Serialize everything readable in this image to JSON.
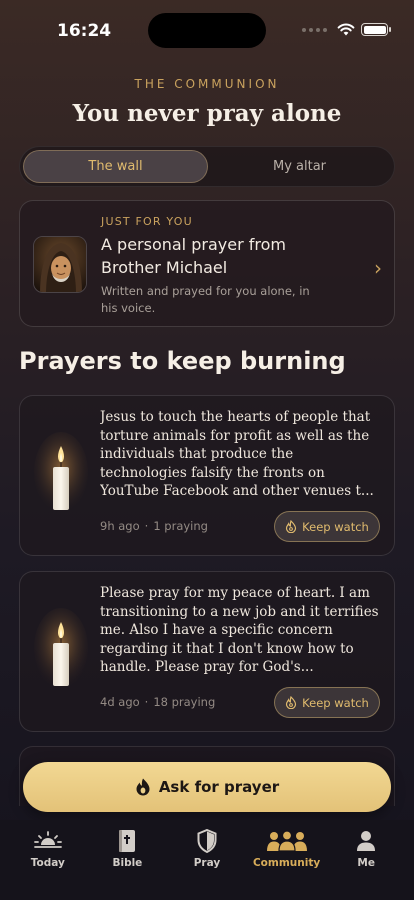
{
  "status_bar": {
    "time": "16:24"
  },
  "header": {
    "eyebrow": "THE COMMUNION",
    "title": "You never pray alone"
  },
  "segments": [
    {
      "label": "The wall",
      "active": true
    },
    {
      "label": "My altar",
      "active": false
    }
  ],
  "featured": {
    "eyebrow": "JUST FOR YOU",
    "title": "A personal prayer from Brother Michael",
    "subtitle": "Written and prayed for you alone, in his voice."
  },
  "section_title": "Prayers to keep burning",
  "prayers": [
    {
      "text": "Jesus to touch the hearts of people that torture animals for profit as well as the individuals that produce the technologies falsify the fronts on YouTube Facebook and other venues t...",
      "time": "9h ago",
      "praying": "1 praying",
      "button": "Keep watch"
    },
    {
      "text": "Please pray for my peace of heart.  I am transitioning to a new job and it terrifies me.  Also I have a specific concern regarding it that I don't know how to handle.  Please pray for God's...",
      "time": "4d ago",
      "praying": "18 praying",
      "button": "Keep watch"
    }
  ],
  "cta": {
    "label": "Ask for prayer"
  },
  "tabs": [
    {
      "label": "Today",
      "icon": "sunrise-icon",
      "active": false
    },
    {
      "label": "Bible",
      "icon": "book-icon",
      "active": false
    },
    {
      "label": "Pray",
      "icon": "shield-icon",
      "active": false
    },
    {
      "label": "Community",
      "icon": "people-icon",
      "active": true
    },
    {
      "label": "Me",
      "icon": "person-icon",
      "active": false
    }
  ],
  "colors": {
    "accent": "#d8ad5a",
    "cta": "#ecd08a",
    "background": "#1e1a24"
  }
}
